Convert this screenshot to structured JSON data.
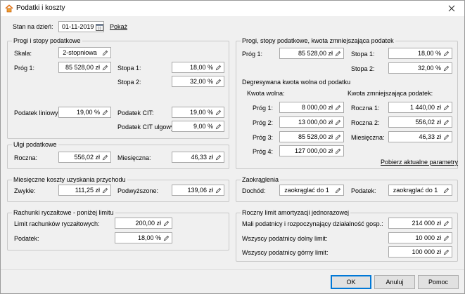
{
  "window": {
    "title": "Podatki i koszty"
  },
  "date_row": {
    "label": "Stan na dzień:",
    "value": "01-11-2019",
    "show_link": "Pokaż"
  },
  "left": {
    "progi": {
      "title": "Progi i stopy podatkowe",
      "skala_label": "Skala:",
      "skala_value": "2-stopniowa",
      "prog1_label": "Próg 1:",
      "prog1_value": "85 528,00 zł",
      "stopa1_label": "Stopa 1:",
      "stopa1_value": "18,00 %",
      "stopa2_label": "Stopa 2:",
      "stopa2_value": "32,00 %",
      "liniowy_label": "Podatek liniowy:",
      "liniowy_value": "19,00 %",
      "cit_label": "Podatek CIT:",
      "cit_value": "19,00 %",
      "cit_ulgowy_label": "Podatek CIT ulgowy:",
      "cit_ulgowy_value": "9,00 %"
    },
    "ulgi": {
      "title": "Ulgi podatkowe",
      "roczna_label": "Roczna:",
      "roczna_value": "556,02 zł",
      "miesieczna_label": "Miesięczna:",
      "miesieczna_value": "46,33 zł"
    },
    "koszty": {
      "title": "Miesięczne koszty uzyskania przychodu",
      "zwykle_label": "Zwykłe:",
      "zwykle_value": "111,25 zł",
      "podwyzszone_label": "Podwyższone:",
      "podwyzszone_value": "139,06 zł"
    },
    "rachunki": {
      "title": "Rachunki ryczałtowe - poniżej limitu",
      "limit_label": "Limit rachunków ryczałtowych:",
      "limit_value": "200,00 zł",
      "podatek_label": "Podatek:",
      "podatek_value": "18,00 %"
    }
  },
  "right": {
    "progi": {
      "title": "Progi, stopy podatkowe, kwota zmniejszająca podatek",
      "prog1_label": "Próg 1:",
      "prog1_value": "85 528,00 zł",
      "stopa1_label": "Stopa 1:",
      "stopa1_value": "18,00 %",
      "stopa2_label": "Stopa 2:",
      "stopa2_value": "32,00 %",
      "degres_title": "Degresywana kwota wolna od podatku",
      "kwota_wolna_header": "Kwota wolna:",
      "kwota_zmn_header": "Kwota zmniejszająca podatek:",
      "kw_prog1_label": "Próg 1:",
      "kw_prog1_value": "8 000,00 zł",
      "kw_prog2_label": "Próg 2:",
      "kw_prog2_value": "13 000,00 zł",
      "kw_prog3_label": "Próg 3:",
      "kw_prog3_value": "85 528,00 zł",
      "kw_prog4_label": "Próg 4:",
      "kw_prog4_value": "127 000,00 zł",
      "kz_roczna1_label": "Roczna 1:",
      "kz_roczna1_value": "1 440,00 zł",
      "kz_roczna2_label": "Roczna 2:",
      "kz_roczna2_value": "556,02 zł",
      "kz_mies_label": "Miesięczna:",
      "kz_mies_value": "46,33 zł",
      "fetch_link": "Pobierz aktualne parametry"
    },
    "zaokr": {
      "title": "Zaokrąglenia",
      "dochod_label": "Dochód:",
      "dochod_value": "zaokrąglać do 1",
      "podatek_label": "Podatek:",
      "podatek_value": "zaokrąglać do 1"
    },
    "limit": {
      "title": "Roczny limit amortyzacji jednorazowej",
      "mali_label": "Mali podatnicy i rozpoczynający działalność gosp.:",
      "mali_value": "214 000 zł",
      "dolny_label": "Wszyscy podatnicy dolny limit:",
      "dolny_value": "10 000 zł",
      "gorny_label": "Wszyscy podatnicy górny limit:",
      "gorny_value": "100 000 zł"
    }
  },
  "buttons": {
    "ok": "OK",
    "cancel": "Anuluj",
    "help": "Pomoc"
  }
}
